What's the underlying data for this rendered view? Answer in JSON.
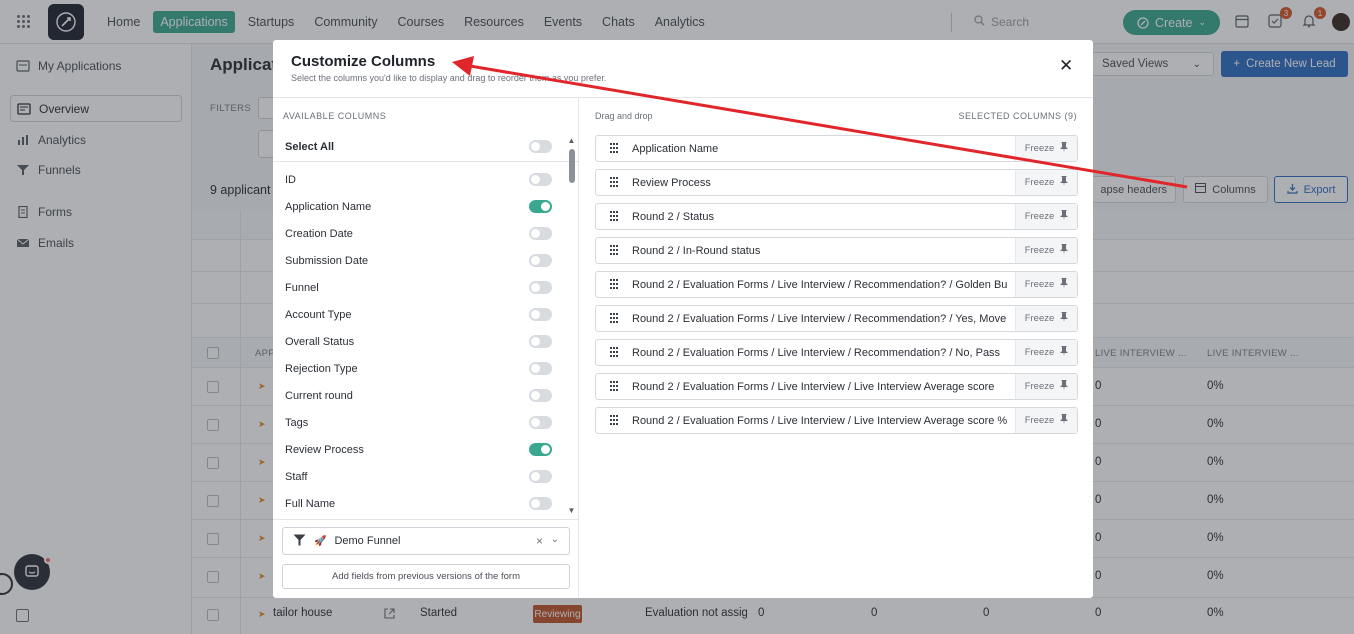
{
  "nav": {
    "items": [
      "Home",
      "Applications",
      "Startups",
      "Community",
      "Courses",
      "Resources",
      "Events",
      "Chats",
      "Analytics"
    ],
    "search_placeholder": "Search",
    "create_label": "Create",
    "tasks_badge": "3",
    "notifications_badge": "1"
  },
  "sidebar": {
    "my_applications": "My Applications",
    "items": [
      "Overview",
      "Analytics",
      "Funnels"
    ],
    "items2": [
      "Forms",
      "Emails"
    ]
  },
  "main": {
    "title": "Applicati",
    "saved_views": "Saved Views",
    "create_new_lead": "Create New Lead",
    "filters_label": "FILTERS",
    "count_label": "9 applicant",
    "collapse_headers": "apse headers",
    "columns": "Columns",
    "export": "Export",
    "header_app": "APP",
    "header_live1": "LIVE INTERVIEW ...",
    "header_live2": "LIVE INTERVIEW ...",
    "rows": [
      {
        "a": "0",
        "b": "0%"
      },
      {
        "a": "0",
        "b": "0%"
      },
      {
        "a": "0",
        "b": "0%"
      },
      {
        "a": "0",
        "b": "0%"
      },
      {
        "a": "0",
        "b": "0%"
      },
      {
        "a": "0",
        "b": "0%"
      }
    ],
    "last_row": {
      "name": "tailor house",
      "status": "Started",
      "review": "Reviewing",
      "eval": "Evaluation not assigi",
      "v1": "0",
      "v2": "0",
      "v3": "0",
      "v4": "0",
      "v5": "0%"
    }
  },
  "modal": {
    "title": "Customize Columns",
    "subtitle": "Select the columns you'd like to display and drag to reorder them as you prefer.",
    "available_label": "AVAILABLE COLUMNS",
    "drag_label": "Drag and drop",
    "selected_label": "SELECTED COLUMNS (9)",
    "select_all": "Select All",
    "available": [
      {
        "label": "ID",
        "on": false
      },
      {
        "label": "Application Name",
        "on": true
      },
      {
        "label": "Creation Date",
        "on": false
      },
      {
        "label": "Submission Date",
        "on": false
      },
      {
        "label": "Funnel",
        "on": false
      },
      {
        "label": "Account Type",
        "on": false
      },
      {
        "label": "Overall Status",
        "on": false
      },
      {
        "label": "Rejection Type",
        "on": false
      },
      {
        "label": "Current round",
        "on": false
      },
      {
        "label": "Tags",
        "on": false
      },
      {
        "label": "Review Process",
        "on": true
      },
      {
        "label": "Staff",
        "on": false
      },
      {
        "label": "Full Name",
        "on": false
      }
    ],
    "funnel_value": "Demo Funnel",
    "add_fields": "Add fields from previous versions of the form",
    "freeze_label": "Freeze",
    "selected": [
      "Application Name",
      "Review Process",
      "Round 2 / Status",
      "Round 2 / In-Round status",
      "Round 2 / Evaluation Forms / Live Interview / Recommendation? / Golden Bu",
      "Round 2 / Evaluation Forms / Live Interview / Recommendation? / Yes, Move",
      "Round 2 / Evaluation Forms / Live Interview / Recommendation? / No, Pass",
      "Round 2 / Evaluation Forms / Live Interview / Live Interview Average score",
      "Round 2 / Evaluation Forms / Live Interview / Live Interview Average score %"
    ]
  },
  "colors": {
    "accent": "#3aa88f",
    "primary": "#2f6ec6",
    "annotation": "#e0262b"
  }
}
